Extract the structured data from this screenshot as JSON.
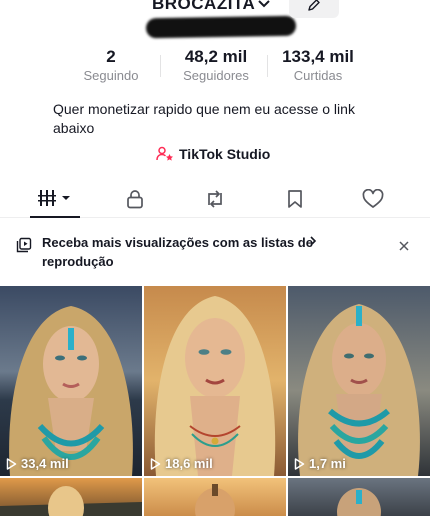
{
  "header": {
    "username": "BROCAZITA",
    "icons": {
      "chevron": "chevron-down-icon",
      "edit": "pencil-icon"
    }
  },
  "stats": [
    {
      "value": "2",
      "label": "Seguindo"
    },
    {
      "value": "48,2 mil",
      "label": "Seguidores"
    },
    {
      "value": "133,4 mil",
      "label": "Curtidas"
    }
  ],
  "bio": {
    "line1": "Quer monetizar rapido que nem eu acesse o link",
    "line2": "abaixo"
  },
  "studio": {
    "label": "TikTok Studio",
    "icon": "user-star-icon",
    "icon_color": "#fe2c55"
  },
  "tabs": [
    {
      "icon": "videos-grid-icon",
      "active": true
    },
    {
      "icon": "lock-icon"
    },
    {
      "icon": "repost-icon"
    },
    {
      "icon": "bookmark-icon"
    },
    {
      "icon": "heart-icon"
    }
  ],
  "banner": {
    "text": "Receba mais visualizações com as listas de reprodução",
    "icon": "playlist-icon",
    "close_icon": "close-icon"
  },
  "videos": [
    {
      "views": "33,4 mil"
    },
    {
      "views": "18,6 mil"
    },
    {
      "views": "1,7 mi"
    },
    {
      "views": ""
    },
    {
      "views": ""
    },
    {
      "views": ""
    }
  ],
  "colors": {
    "text": "#161823",
    "secondary": "#8a8b91",
    "accent": "#fe2c55",
    "divider": "#eeeeef"
  }
}
